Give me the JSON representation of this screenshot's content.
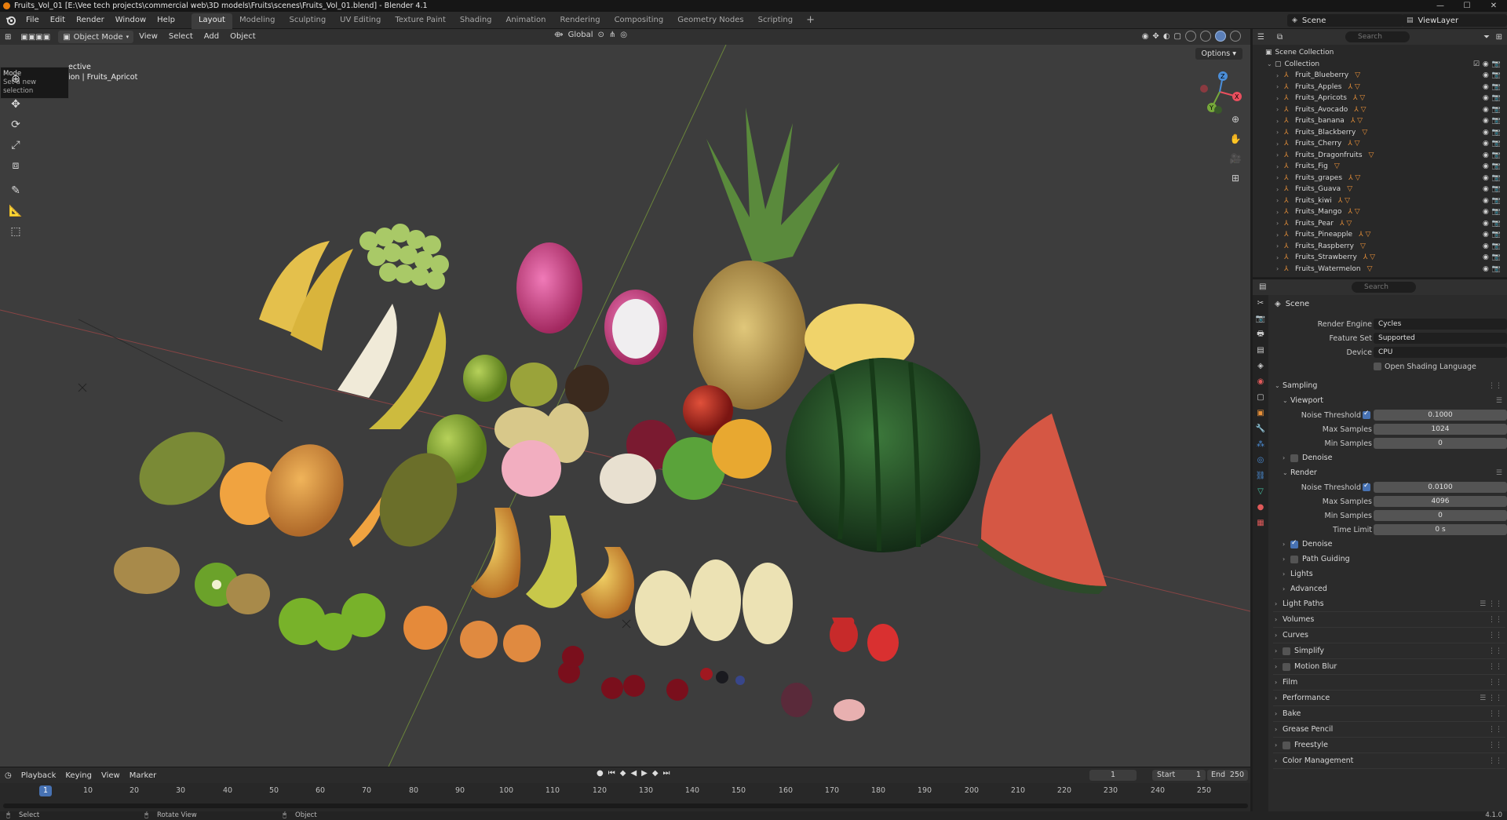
{
  "title_bar": {
    "text": "Fruits_Vol_01 [E:\\Vee tech projects\\commercial web\\3D models\\Fruits\\scenes\\Fruits_Vol_01.blend] - Blender 4.1",
    "min": "—",
    "max": "☐",
    "close": "✕"
  },
  "menu": {
    "items": [
      "File",
      "Edit",
      "Render",
      "Window",
      "Help"
    ],
    "workspaces": [
      "Layout",
      "Modeling",
      "Sculpting",
      "UV Editing",
      "Texture Paint",
      "Shading",
      "Animation",
      "Rendering",
      "Compositing",
      "Geometry Nodes",
      "Scripting"
    ],
    "active_workspace": "Layout",
    "add": "+",
    "scene": "Scene",
    "view_layer": "ViewLayer"
  },
  "viewport": {
    "mode": "Object Mode",
    "menus": [
      "View",
      "Select",
      "Add",
      "Object"
    ],
    "transform_orientation": "Global",
    "options": "Options",
    "info_line1": "ective",
    "info_line2": "ion | Fruits_Apricot",
    "tooltip_title": "Mode",
    "tooltip_sub": "Set a new selection"
  },
  "timeline": {
    "menus": [
      "Playback",
      "Keying",
      "View",
      "Marker"
    ],
    "current_frame": "1",
    "frame_field": "1",
    "start_label": "Start",
    "start_value": "1",
    "end_label": "End",
    "end_value": "250",
    "ticks": [
      "10",
      "20",
      "30",
      "40",
      "50",
      "60",
      "70",
      "80",
      "90",
      "100",
      "110",
      "120",
      "130",
      "140",
      "150",
      "160",
      "170",
      "180",
      "190",
      "200",
      "210",
      "220",
      "230",
      "240",
      "250"
    ]
  },
  "status_bar": {
    "select": "Select",
    "rotate": "Rotate View",
    "object": "Object",
    "version": "4.1.0"
  },
  "outliner": {
    "search_placeholder": "Search",
    "scene_collection": "Scene Collection",
    "collection": "Collection",
    "items": [
      {
        "name": "Fruit_Blueberry",
        "mods": "▽"
      },
      {
        "name": "Fruits_Apples",
        "mods": "⅄ ▽"
      },
      {
        "name": "Fruits_Apricots",
        "mods": "⅄ ▽"
      },
      {
        "name": "Fruits_Avocado",
        "mods": "⅄ ▽"
      },
      {
        "name": "Fruits_banana",
        "mods": "⅄ ▽"
      },
      {
        "name": "Fruits_Blackberry",
        "mods": "▽"
      },
      {
        "name": "Fruits_Cherry",
        "mods": "⅄ ▽"
      },
      {
        "name": "Fruits_Dragonfruits",
        "mods": "▽"
      },
      {
        "name": "Fruits_Fig",
        "mods": "▽"
      },
      {
        "name": "Fruits_grapes",
        "mods": "⅄ ▽"
      },
      {
        "name": "Fruits_Guava",
        "mods": "▽"
      },
      {
        "name": "Fruits_kiwi",
        "mods": "⅄ ▽"
      },
      {
        "name": "Fruits_Mango",
        "mods": "⅄ ▽"
      },
      {
        "name": "Fruits_Pear",
        "mods": "⅄ ▽"
      },
      {
        "name": "Fruits_Pineapple",
        "mods": "⅄ ▽"
      },
      {
        "name": "Fruits_Raspberry",
        "mods": "▽"
      },
      {
        "name": "Fruits_Strawberry",
        "mods": "⅄ ▽"
      },
      {
        "name": "Fruits_Watermelon",
        "mods": "▽"
      }
    ]
  },
  "properties": {
    "search_placeholder": "Search",
    "context": "Scene",
    "render_engine_label": "Render Engine",
    "render_engine": "Cycles",
    "feature_set_label": "Feature Set",
    "feature_set": "Supported",
    "device_label": "Device",
    "device": "CPU",
    "osl_label": "Open Shading Language",
    "sampling": "Sampling",
    "viewport": "Viewport",
    "noise_threshold_label": "Noise Threshold",
    "vp_noise_threshold": "0.1000",
    "max_samples_label": "Max Samples",
    "vp_max_samples": "1024",
    "min_samples_label": "Min Samples",
    "vp_min_samples": "0",
    "denoise": "Denoise",
    "render": "Render",
    "r_noise_threshold": "0.0100",
    "r_max_samples": "4096",
    "r_min_samples": "0",
    "time_limit_label": "Time Limit",
    "time_limit": "0 s",
    "path_guiding": "Path Guiding",
    "lights": "Lights",
    "advanced": "Advanced",
    "panels": [
      "Light Paths",
      "Volumes",
      "Curves",
      "Simplify",
      "Motion Blur",
      "Film",
      "Performance",
      "Bake",
      "Grease Pencil",
      "Freestyle",
      "Color Management"
    ]
  }
}
